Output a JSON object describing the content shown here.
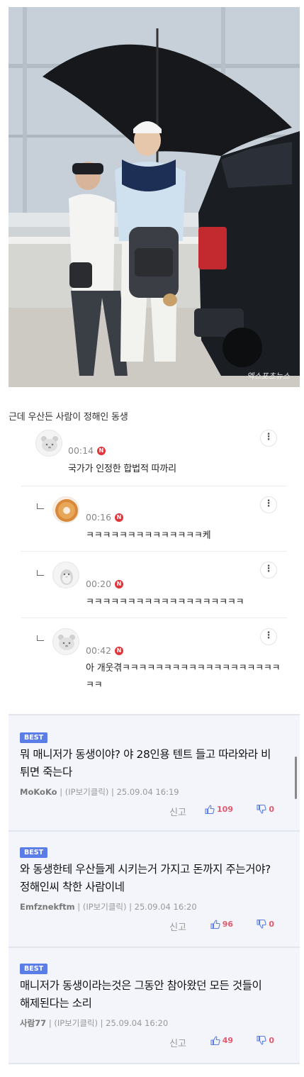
{
  "photo": {
    "watermark": "엑스포츠뉴스"
  },
  "caption": "근데 우산든 사람이 정해인 동생",
  "comments": [
    {
      "time": "00:14",
      "badge": "N",
      "text": "국가가 인정한 합법적 따까리",
      "avatar": "bear-face-icon"
    },
    {
      "time": "00:16",
      "badge": "N",
      "text": "ㅋㅋㅋㅋㅋㅋㅋㅋㅋㅋㅋㅋㅋㅋ케",
      "avatar": "donut-icon"
    },
    {
      "time": "00:20",
      "badge": "N",
      "text": "ㅋㅋㅋㅋㅋㅋㅋㅋㅋㅋㅋㅋㅋㅋㅋㅋㅋㅋㅋ",
      "avatar": "penguin-icon"
    },
    {
      "time": "00:42",
      "badge": "N",
      "text_line1": "아 개웃겪ㅋㅋㅋㅋㅋㅋㅋㅋㅋㅋㅋㅋㅋㅋㅋㅋㅋㅋㅋ",
      "text_line2": "ㅋㅋ",
      "avatar": "bear-face-icon"
    }
  ],
  "more_label": "⋮",
  "best": [
    {
      "badge": "BEST",
      "line1": "뭐 매니저가 동생이야? 야 28인용 텐트 들고 따라와라 비",
      "line2": "튀면 죽는다",
      "author": "MoKoKo",
      "ip": "(IP보기클릭)",
      "date": "25.09.04 16:19",
      "report": "신고",
      "likes": "109",
      "dislikes": "0"
    },
    {
      "badge": "BEST",
      "line1": "와 동생한테 우산들게 시키는거 가지고 돈까지 주는거야?",
      "line2": "정해인씨 착한 사람이네",
      "author": "Emfznekftm",
      "ip": "(IP보기클릭)",
      "date": "25.09.04 16:20",
      "report": "신고",
      "likes": "96",
      "dislikes": "0"
    },
    {
      "badge": "BEST",
      "line1": "매니저가 동생이라는것은   그동안 참아왔던 모든 것들이",
      "line2": "해제된다는 소리",
      "author": "사람77",
      "ip": "(IP보기클릭)",
      "date": "25.09.04 16:20",
      "report": "신고",
      "likes": "49",
      "dislikes": "0"
    }
  ],
  "colors": {
    "accent_badge": "#5b7de8",
    "new_badge": "#e2343b",
    "like": "#e05a6f",
    "best_bg": "#f3f5fa"
  }
}
